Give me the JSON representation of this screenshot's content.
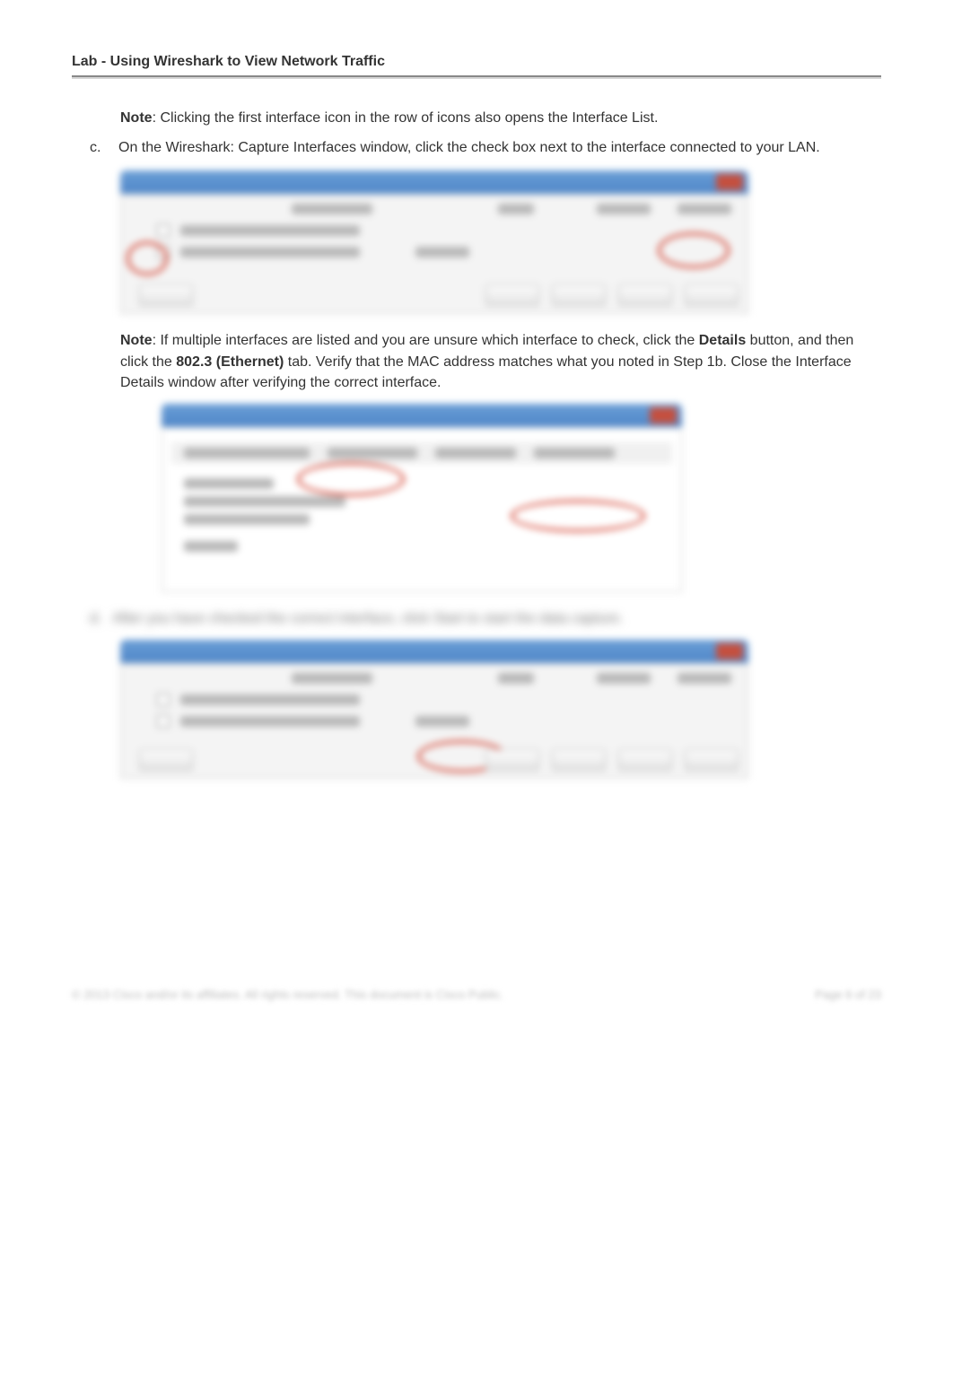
{
  "title": "Lab - Using Wireshark to View Network Traffic",
  "note1_prefix": "Note",
  "note1_text": ": Clicking the first interface icon in the row of icons also opens the Interface List.",
  "step_c_marker": "c.",
  "step_c_text": "On the Wireshark: Capture Interfaces window, click the check box next to the interface connected to your LAN.",
  "note2_prefix": "Note",
  "note2_before": ": If multiple interfaces are listed and you are unsure which interface to check, click the ",
  "details_word": "Details",
  "note2_mid": " button, and then click the ",
  "ethernet_word": "802.3 (Ethernet)",
  "note2_after": " tab. Verify that the MAC address matches what you noted in Step 1b. Close the Interface Details window after verifying the correct interface.",
  "step_d_marker": "d.",
  "step_d_text": "After you have checked the correct interface, click Start to start the data capture.",
  "footer_left": "© 2013 Cisco and/or its affiliates. All rights reserved. This document is Cisco Public.",
  "footer_right": "Page 6 of 23"
}
